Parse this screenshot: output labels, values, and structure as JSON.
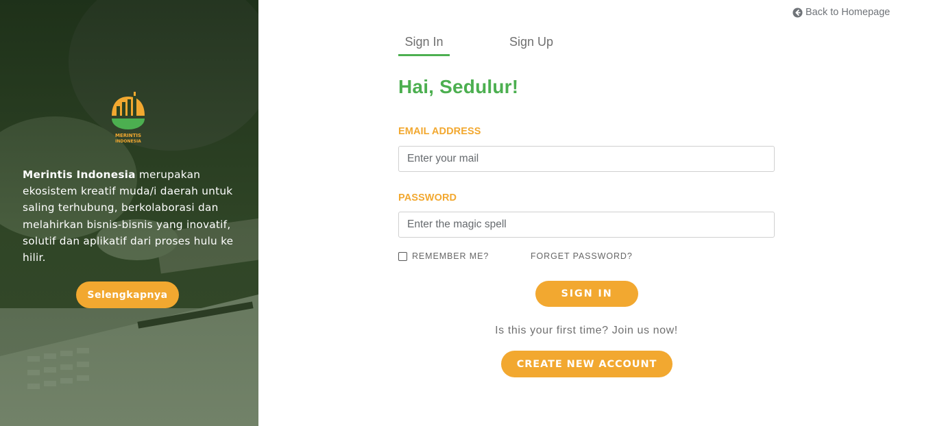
{
  "hero": {
    "logo_text_line1": "MERINTIS",
    "logo_text_line2": "INDONESIA",
    "brand_name": "Merintis Indonesia",
    "description": " merupakan ekosistem kreatif muda/i daerah untuk saling terhubung, berkolaborasi dan melahirkan bisnis-bisnis yang inovatif, solutif dan aplikatif dari proses hulu ke hilir.",
    "button_label": "Selengkapnya"
  },
  "nav": {
    "back_label": "Back to Homepage",
    "back_icon": "arrow-circle-left-icon"
  },
  "tabs": [
    {
      "label": "Sign In",
      "active": true
    },
    {
      "label": "Sign Up",
      "active": false
    }
  ],
  "form": {
    "greeting": "Hai, Sedulur!",
    "email_label": "EMAIL ADDRESS",
    "email_placeholder": "Enter your mail",
    "email_value": "",
    "password_label": "PASSWORD",
    "password_placeholder": "Enter the magic spell",
    "password_value": "",
    "remember_label": "REMEMBER ME?",
    "remember_checked": false,
    "forget_label": "FORGET PASSWORD?",
    "signin_button": "SIGN IN",
    "first_time_text": "Is this your first time? Join us now!",
    "create_button": "CREATE NEW ACCOUNT"
  },
  "colors": {
    "primary_green": "#4caf50",
    "accent_orange": "#f2a830",
    "hero_overlay": "#2d4322"
  }
}
